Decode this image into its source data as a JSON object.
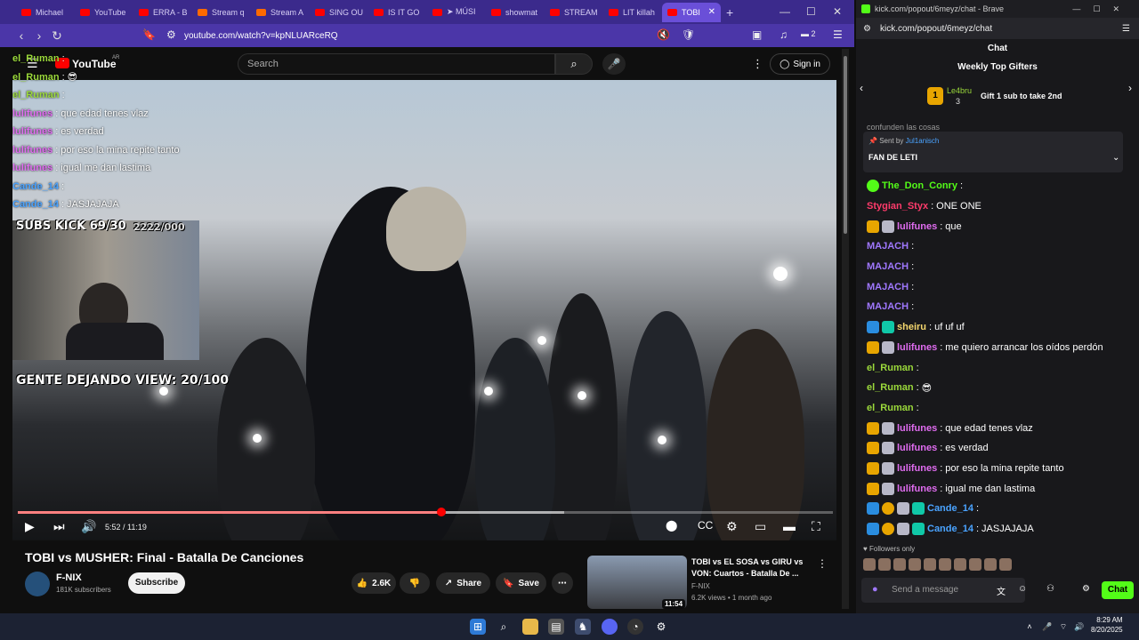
{
  "browser": {
    "tabs": [
      {
        "label": "Michael"
      },
      {
        "label": "YouTube"
      },
      {
        "label": "ERRA - B"
      },
      {
        "label": "Stream q"
      },
      {
        "label": "Stream A"
      },
      {
        "label": "SING OU"
      },
      {
        "label": "IS IT GO"
      },
      {
        "label": "➤ MÚSI"
      },
      {
        "label": "showmat"
      },
      {
        "label": "STREAM"
      },
      {
        "label": "LIT killah"
      },
      {
        "label": "TOBI"
      }
    ],
    "url": "youtube.com/watch?v=kpNLUARceRQ",
    "ext_count": "2"
  },
  "youtube": {
    "logo": "YouTube",
    "region": "AR",
    "search_placeholder": "Search",
    "signin": "Sign in",
    "time": "5:52 / 11:19",
    "progress": 0.52,
    "buffered": 0.67,
    "video_title": "TOBI vs MUSHER: Final - Batalla De Canciones",
    "channel": "F-NIX",
    "subscribers": "181K subscribers",
    "subscribe": "Subscribe",
    "likes": "2.6K",
    "share": "Share",
    "save": "Save",
    "rec": {
      "title": "TOBI vs EL SOSA vs GIRU vs VON: Cuartos - Batalla De ...",
      "channel": "F-NIX",
      "meta": "6.2K views • 1 month ago",
      "duration": "11:54"
    }
  },
  "overlay": {
    "lines": [
      {
        "name": "el_Ruman",
        "text": "",
        "cls": "n"
      },
      {
        "name": "el_Ruman",
        "text": "😎",
        "cls": "n"
      },
      {
        "name": "el_Ruman",
        "text": "",
        "cls": "n"
      },
      {
        "name": "lulifunes",
        "text": "que edad tenes vlaz",
        "cls": "n p"
      },
      {
        "name": "lulifunes",
        "text": "es verdad",
        "cls": "n p"
      },
      {
        "name": "lulifunes",
        "text": "por eso la mina repite tanto",
        "cls": "n p"
      },
      {
        "name": "lulifunes",
        "text": "igual me dan lastima",
        "cls": "n p"
      },
      {
        "name": "Cande_14",
        "text": "",
        "cls": "n b"
      },
      {
        "name": "Cande_14",
        "text": "JASJAJAJA",
        "cls": "n b"
      }
    ],
    "subs_kick": "SUBS KICK 69/30",
    "goal": "2222/000",
    "gente": "GENTE DEJANDO VIEW: 20/100"
  },
  "kick": {
    "window_url": "kick.com/popout/6meyz/chat - Brave",
    "url": "kick.com/popout/6meyz/chat",
    "chat_title": "Chat",
    "gifters_title": "Weekly Top Gifters",
    "top_gifter": "Le4bru",
    "top_gifter_count": "3",
    "gift_cta": "Gift 1 sub to take 2nd",
    "partial_text": "confunden las cosas",
    "pinned_by_label": "Sent by",
    "pinned_by": "Jul1anisch",
    "pinned_text": "FAN DE LETI",
    "messages": [
      {
        "user": "The_Don_Conry",
        "color": "#53fc18",
        "text": "",
        "badges": [
          "b-green"
        ]
      },
      {
        "user": "Stygian_Styx",
        "color": "#ff3b6b",
        "text": "ONE  ONE",
        "badges": []
      },
      {
        "user": "lulifunes",
        "color": "#e06cf0",
        "text": "que",
        "badges": [
          "b-crown",
          "b-gift"
        ]
      },
      {
        "user": "MAJACH",
        "color": "#a078ff",
        "text": "",
        "badges": []
      },
      {
        "user": "MAJACH",
        "color": "#a078ff",
        "text": "",
        "badges": []
      },
      {
        "user": "MAJACH",
        "color": "#a078ff",
        "text": "",
        "badges": []
      },
      {
        "user": "MAJACH",
        "color": "#a078ff",
        "text": "",
        "badges": []
      },
      {
        "user": "sheiru",
        "color": "#f5d76e",
        "text": "uf uf uf",
        "badges": [
          "b-blue",
          "b-teal"
        ]
      },
      {
        "user": "lulifunes",
        "color": "#e06cf0",
        "text": "me quiero arrancar los oídos perdón",
        "badges": [
          "b-crown",
          "b-gift"
        ]
      },
      {
        "user": "el_Ruman",
        "color": "#9bd93b",
        "text": "",
        "badges": []
      },
      {
        "user": "el_Ruman",
        "color": "#9bd93b",
        "text": "😎",
        "badges": []
      },
      {
        "user": "el_Ruman",
        "color": "#9bd93b",
        "text": "",
        "badges": []
      },
      {
        "user": "lulifunes",
        "color": "#e06cf0",
        "text": "que edad tenes vlaz",
        "badges": [
          "b-crown",
          "b-gift"
        ]
      },
      {
        "user": "lulifunes",
        "color": "#e06cf0",
        "text": "es verdad",
        "badges": [
          "b-crown",
          "b-gift"
        ]
      },
      {
        "user": "lulifunes",
        "color": "#e06cf0",
        "text": "por eso la mina repite tanto",
        "badges": [
          "b-crown",
          "b-gift"
        ]
      },
      {
        "user": "lulifunes",
        "color": "#e06cf0",
        "text": "igual me dan lastima",
        "badges": [
          "b-crown",
          "b-gift"
        ]
      },
      {
        "user": "Cande_14",
        "color": "#4aa3ff",
        "text": "",
        "badges": [
          "b-blue",
          "b-one",
          "b-gift",
          "b-teal"
        ]
      },
      {
        "user": "Cande_14",
        "color": "#4aa3ff",
        "text": "JASJAJAJA",
        "badges": [
          "b-blue",
          "b-one",
          "b-gift",
          "b-teal"
        ]
      }
    ],
    "followers_only": "Followers only",
    "input_placeholder": "Send a message",
    "chat_button": "Chat"
  },
  "taskbar": {
    "time": "8:29 AM",
    "date": "8/20/2025"
  },
  "colors": {
    "kick_green": "#53fc18",
    "brave_purple": "#3b2a8c",
    "yt_red": "#ff0000"
  }
}
